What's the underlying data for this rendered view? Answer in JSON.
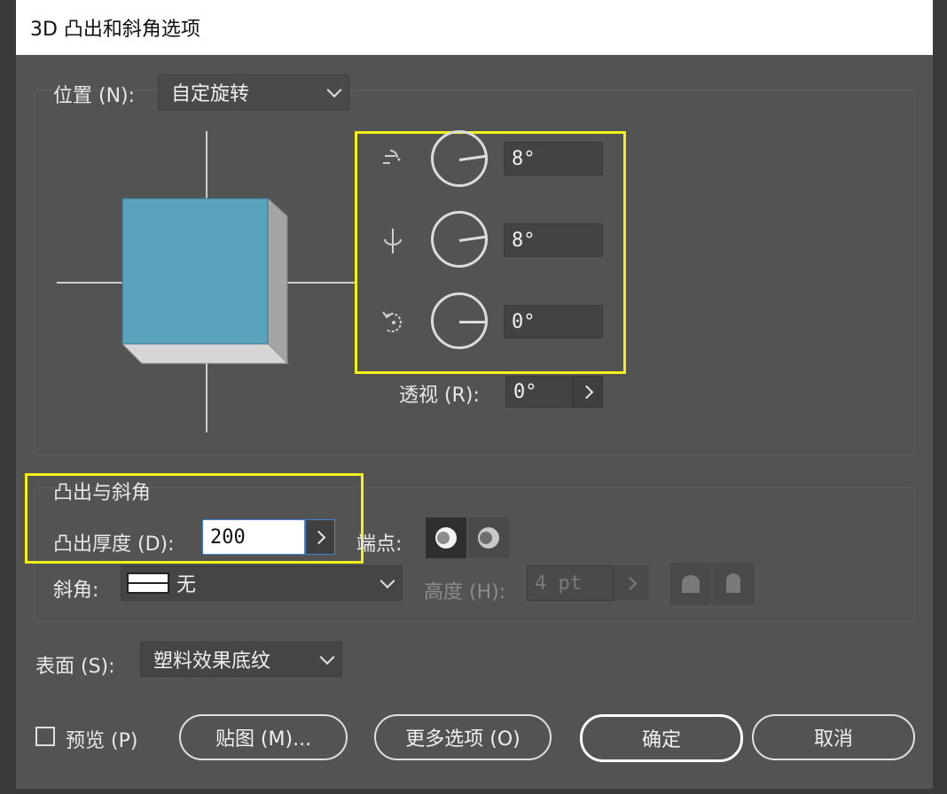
{
  "dialog_title": "3D 凸出和斜角选项",
  "position": {
    "label": "位置 (N):",
    "preset_value": "自定旋转",
    "rot_x": "8°",
    "rot_y": "8°",
    "rot_z": "0°",
    "perspective_label": "透视 (R):",
    "perspective_value": "0°"
  },
  "extrude": {
    "section_label": "凸出与斜角",
    "depth_label": "凸出厚度 (D):",
    "depth_value": "200",
    "cap_label": "端点:",
    "bevel_label": "斜角:",
    "bevel_value": "无",
    "height_label": "高度 (H):",
    "height_value": "4 pt"
  },
  "surface": {
    "label": "表面 (S):",
    "value": "塑料效果底纹"
  },
  "footer": {
    "preview_label": "预览 (P)",
    "map_art_button": "贴图 (M)...",
    "more_options_button": "更多选项 (O)",
    "ok_button": "确定",
    "cancel_button": "取消"
  },
  "colors": {
    "highlight": "#f2f21a",
    "cube_front": "#5aa3bd",
    "dialog_bg": "#535353"
  }
}
